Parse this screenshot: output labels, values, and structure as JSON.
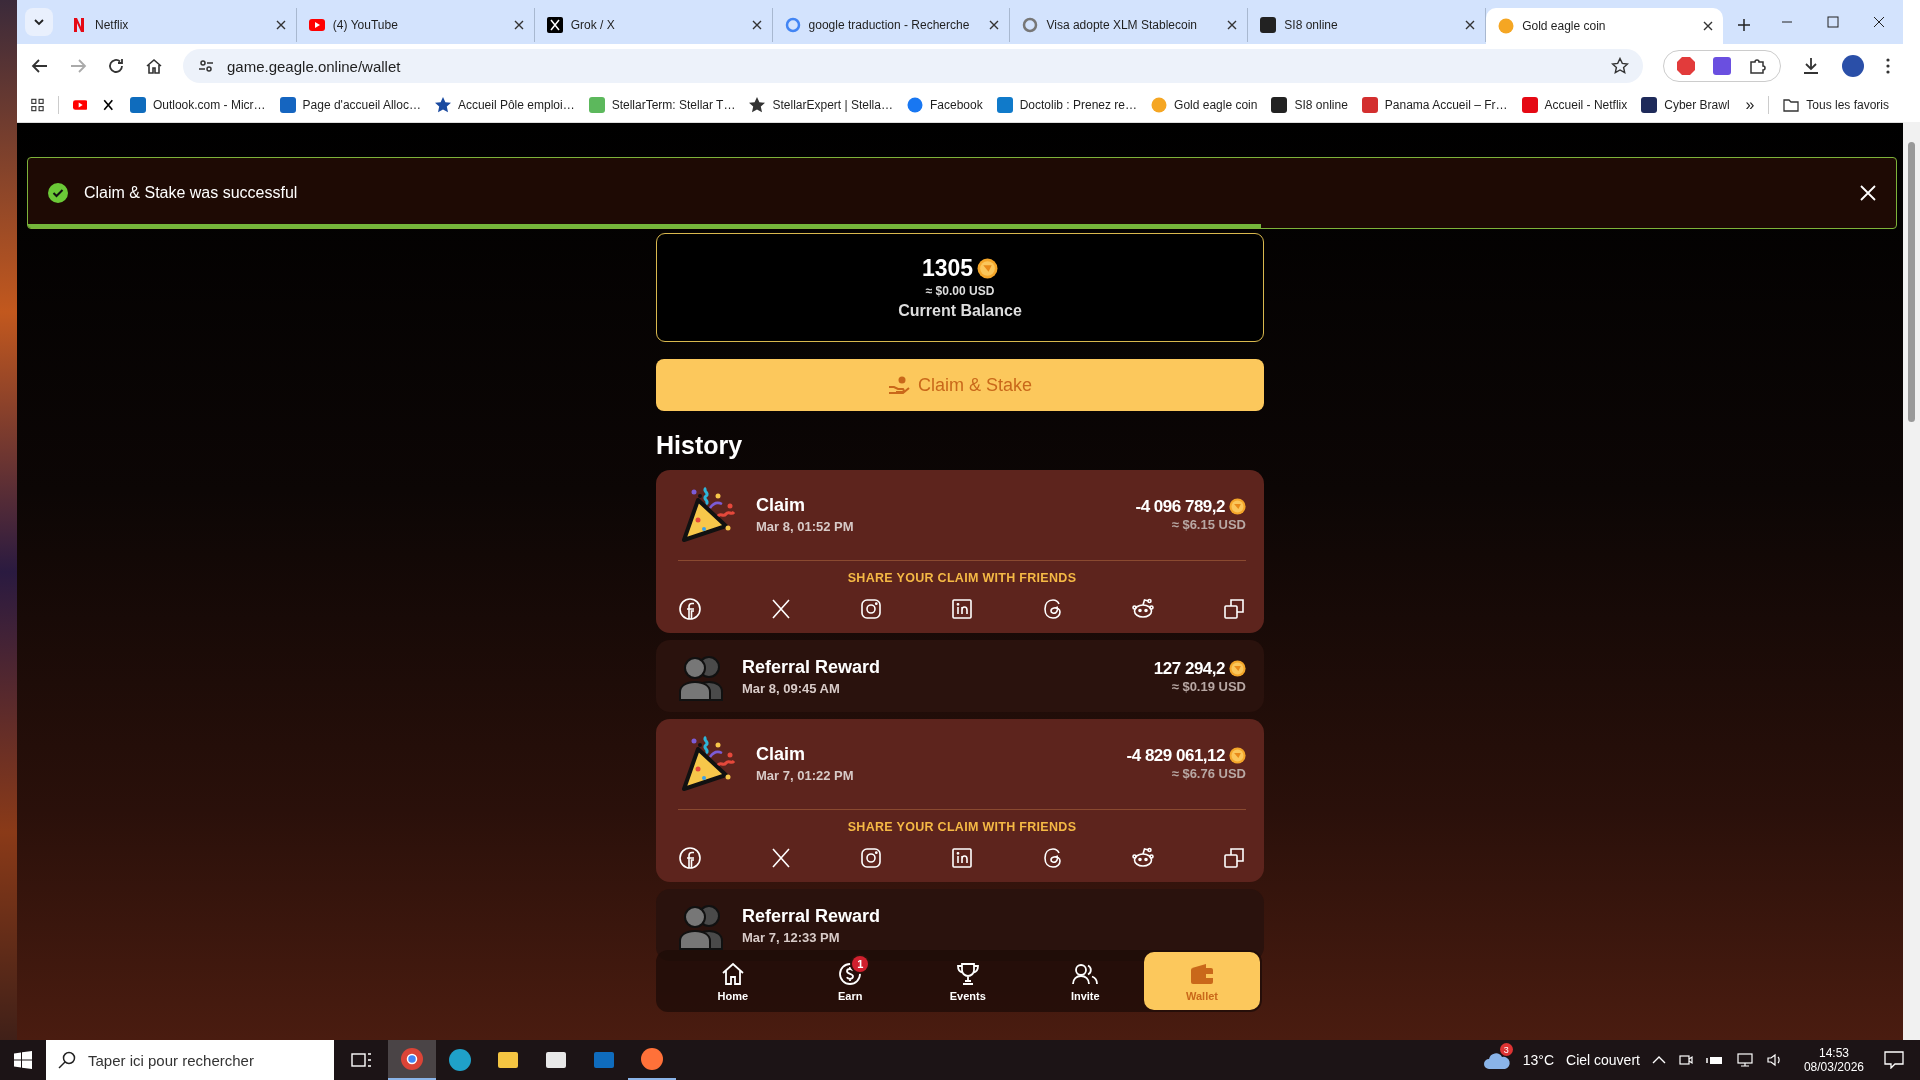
{
  "browser": {
    "tabs": [
      {
        "title": "Netflix",
        "selected": false
      },
      {
        "title": "(4) YouTube",
        "selected": false
      },
      {
        "title": "Grok / X",
        "selected": false
      },
      {
        "title": "google traduction - Recherche",
        "selected": false
      },
      {
        "title": "Visa adopte XLM Stablecoin",
        "selected": false
      },
      {
        "title": "SI8 online",
        "selected": false
      },
      {
        "title": "Gold eagle coin",
        "selected": true
      }
    ],
    "url": "game.geagle.online/wallet",
    "bookmarks": [
      {
        "label": "Outlook.com - Micr…"
      },
      {
        "label": "Page d'accueil Alloc…"
      },
      {
        "label": "Accueil Pôle emploi…"
      },
      {
        "label": "StellarTerm: Stellar T…"
      },
      {
        "label": "StellarExpert | Stella…"
      },
      {
        "label": "Facebook"
      },
      {
        "label": "Doctolib : Prenez re…"
      },
      {
        "label": "Gold eagle coin"
      },
      {
        "label": "SI8 online"
      },
      {
        "label": "Panama Accueil – Fr…"
      },
      {
        "label": "Accueil - Netflix"
      },
      {
        "label": "Cyber Brawl"
      }
    ],
    "more": "»",
    "all_bookmarks": "Tous les favoris"
  },
  "toast": {
    "message": "Claim & Stake was successful",
    "level": 0.66
  },
  "balance": {
    "amount": "1305",
    "usd": "≈ $0.00 USD",
    "label": "Current Balance"
  },
  "claim_button": "Claim & Stake",
  "history": {
    "title": "History",
    "items": [
      {
        "kind": "claim",
        "title": "Claim",
        "date": "Mar 8, 01:52 PM",
        "amount": "-4 096 789,2",
        "usd": "≈ $6.15 USD",
        "share_label": "SHARE YOUR CLAIM WITH FRIENDS"
      },
      {
        "kind": "referral",
        "title": "Referral Reward",
        "date": "Mar 8, 09:45 AM",
        "amount": "127 294,2",
        "usd": "≈ $0.19 USD"
      },
      {
        "kind": "claim",
        "title": "Claim",
        "date": "Mar 7, 01:22 PM",
        "amount": "-4 829 061,12",
        "usd": "≈ $6.76 USD",
        "share_label": "SHARE YOUR CLAIM WITH FRIENDS"
      },
      {
        "kind": "referral",
        "title": "Referral Reward",
        "date": "Mar 7, 12:33 PM"
      }
    ]
  },
  "nav": [
    {
      "label": "Home",
      "selected": false
    },
    {
      "label": "Earn",
      "selected": false,
      "badge": "1"
    },
    {
      "label": "Events",
      "selected": false
    },
    {
      "label": "Invite",
      "selected": false
    },
    {
      "label": "Wallet",
      "selected": true
    }
  ],
  "taskbar": {
    "search_placeholder": "Taper ici pour rechercher",
    "apps": [
      {
        "selected": true,
        "running": true
      },
      {
        "selected": false,
        "running": false
      },
      {
        "selected": false,
        "running": false
      },
      {
        "selected": false,
        "running": false
      },
      {
        "selected": false,
        "running": false
      },
      {
        "selected": false,
        "running": true
      }
    ],
    "weather_badge": "3",
    "temperature": "13°C",
    "weather": "Ciel couvert",
    "time": "14:53",
    "date": "08/03/2026"
  }
}
